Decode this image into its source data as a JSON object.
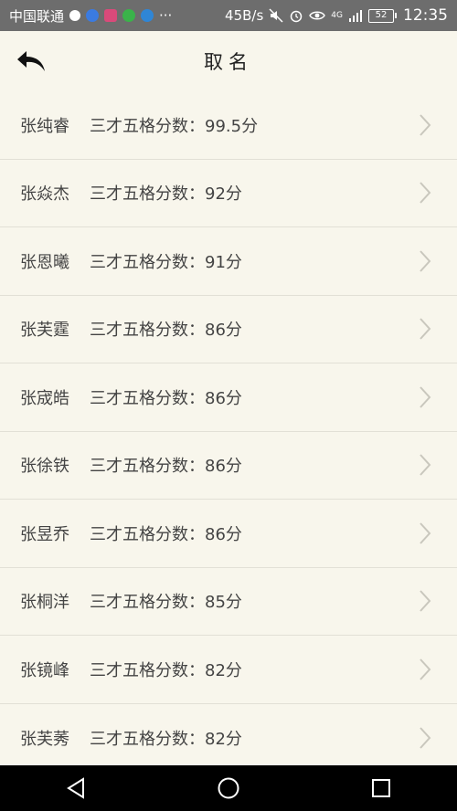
{
  "status_bar": {
    "carrier": "中国联通",
    "speed": "45B/s",
    "network": "4G",
    "battery": "52",
    "time": "12:35"
  },
  "header": {
    "title": "取名",
    "back_icon": "back-arrow-icon"
  },
  "names": [
    {
      "name": "张纯睿",
      "score": "三才五格分数：99.5分"
    },
    {
      "name": "张焱杰",
      "score": "三才五格分数：92分"
    },
    {
      "name": "张恩曦",
      "score": "三才五格分数：91分"
    },
    {
      "name": "张芙霆",
      "score": "三才五格分数：86分"
    },
    {
      "name": "张宬皓",
      "score": "三才五格分数：86分"
    },
    {
      "name": "张徐铁",
      "score": "三才五格分数：86分"
    },
    {
      "name": "张昱乔",
      "score": "三才五格分数：86分"
    },
    {
      "name": "张桐洋",
      "score": "三才五格分数：85分"
    },
    {
      "name": "张镜峰",
      "score": "三才五格分数：82分"
    },
    {
      "name": "张芙莠",
      "score": "三才五格分数：82分"
    }
  ],
  "colors": {
    "background": "#f8f6ec",
    "status_bar": "#6d6d6d",
    "nav_bar": "#000000",
    "divider": "#e2e0d6"
  }
}
